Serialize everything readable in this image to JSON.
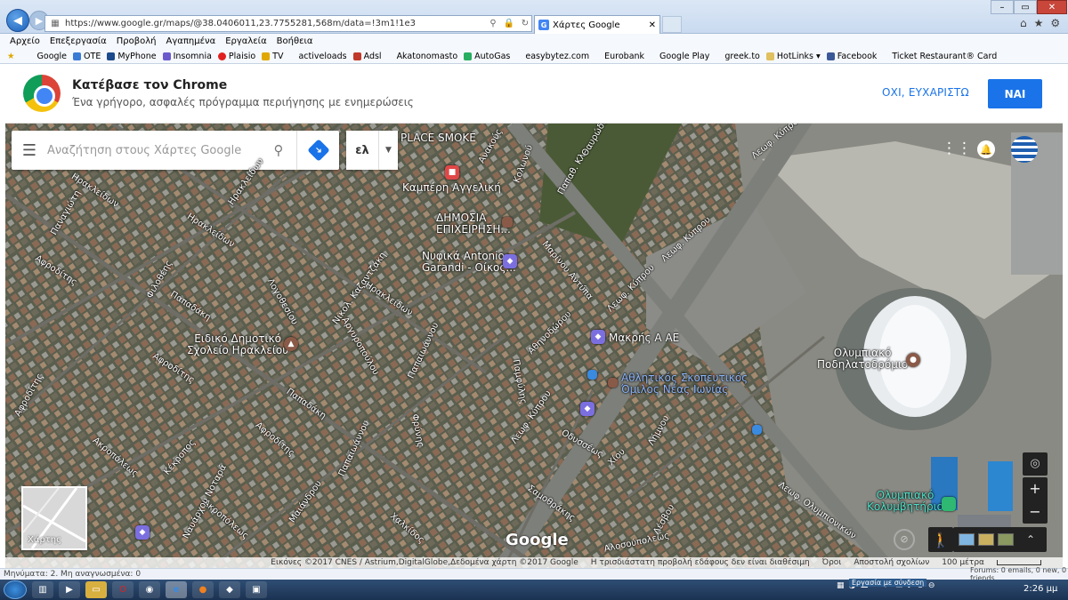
{
  "browser": {
    "url": "https://www.google.gr/maps/@38.0406011,23.7755281,568m/data=!3m1!1e3",
    "tab_title": "Χάρτες Google",
    "menu": [
      "Αρχείο",
      "Επεξεργασία",
      "Προβολή",
      "Αγαπημένα",
      "Εργαλεία",
      "Βοήθεια"
    ],
    "favorites": [
      "Google",
      "OTE",
      "MyPhone",
      "Insomnia",
      "Plaisio",
      "TV",
      "activeloads",
      "Adsl",
      "Akatonomasto",
      "AutoGas",
      "easybytez.com",
      "Eurobank",
      "Google Play",
      "greek.to",
      "HotLinks",
      "Facebook",
      "Ticket Restaurant® Card"
    ],
    "status_text": "Μηνύματα: 2. Μη αναγνωσμένα: 0",
    "status_right": "Forums: 0 emails, 0 new, 0 friends"
  },
  "banner": {
    "title": "Κατέβασε τον Chrome",
    "subtitle": "Ένα γρήγορο, ασφαλές πρόγραμμα περιήγησης με ενημερώσεις",
    "no_label": "ΟΧΙ, ΕΥΧΑΡΙΣΤΩ",
    "yes_label": "ΝΑΙ"
  },
  "map": {
    "search_placeholder": "Αναζήτηση στους Χάρτες Google",
    "lang_label": "ελ",
    "minimap_label": "Χάρτης",
    "google_logo": "Google",
    "labels": {
      "place_smoke": "PLACE SMOKE",
      "kamperi": "Καμπέρη Αγγελική",
      "dimosia": "ΔΗΜΟΣΙΑ\nΕΠΙΧΕΙΡΗΣΗ...",
      "nufika": "Νυφικά Antonio\nGarandi - Οίκος...",
      "makris": "Μακρής Α ΑΕ",
      "eidiko": "Ειδικό Δημοτικό\nΣχολείο Ηρακλείου",
      "athlitikos": "Αθλητικός Σκοπευτικός\nΌμιλος Νέας Ιωνίας",
      "podilato": "Ολυμπιακό\nΠοδηλατοδρόμιο",
      "kolymvitirio": "Ολυμπιακό\nΚολυμβητήριο"
    },
    "streets": [
      "Λεωφ. Κύπρου",
      "Λεωφ. Κύπρου",
      "Λεωφ. Κύπρου",
      "Λεωφ. Κύπρου",
      "Μαρίνου Αντύπα",
      "Ηρακλείδων",
      "Ηρακλείδων",
      "Ηρακλείδων",
      "Λογοθεσίου",
      "Νικολ. Καζαντζάκη",
      "Αργυροπούλου",
      "Παπαδάκη",
      "Παπαδάκη",
      "Αφροδίτης",
      "Αφροδίτης",
      "Αφροδίτης",
      "Αφροδίτης",
      "Ακροπόλεως",
      "Ακροπόλεως",
      "Ναυάρχου Νοταρά",
      "Κέκροπος",
      "Παπαϊωάννου",
      "Παπαϊωάννου",
      "Φρύνης",
      "Σαμοθράκης",
      "Αλοσούπολεως",
      "Λεωφ. Ολυμπιονικών",
      "Αθηνοδώρου",
      "Παμφύλης",
      "Λέσβου",
      "Λήμνου",
      "Χίου",
      "Οδυσσέως",
      "Κολωνού",
      "Ανακούς",
      "Παπαθ. Κλ.",
      "Θαυρώδους",
      "Παναγιώτη",
      "Φιλοθέης",
      "Μαιάνδρου",
      "Χαλκίδος",
      "Ηρακλείδων"
    ],
    "footer": {
      "imagery": "Εικόνες ©2017 CNES / Astrium,DigitalGlobe,Δεδομένα χάρτη ©2017 Google",
      "no_3d": "Η τρισδιάστατη προβολή εδάφους δεν είναι διαθέσιμη",
      "terms": "Όροι",
      "feedback": "Αποστολή σχολίων",
      "scale": "100 μέτρα"
    }
  },
  "taskbar": {
    "clock": "2:26 μμ",
    "notification": "Εργασία με σύνδεση"
  },
  "colors": {
    "accent": "#1a73e8",
    "map_bg": "#4e5643",
    "road": "#7d7f7a"
  }
}
